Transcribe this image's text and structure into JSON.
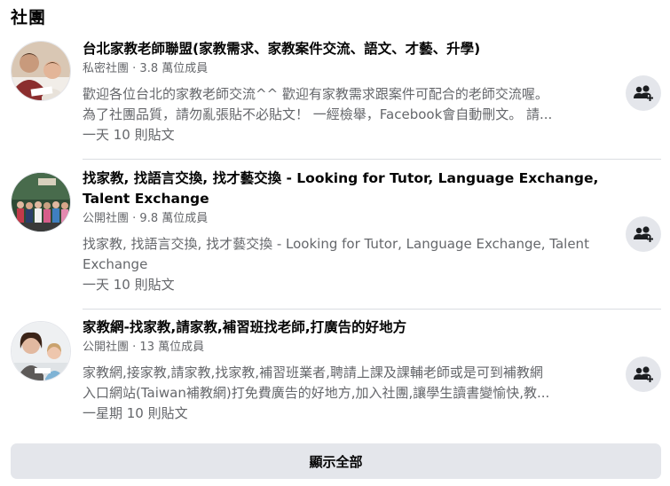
{
  "section": {
    "title": "社團"
  },
  "groups": [
    {
      "name": "台北家教老師聯盟(家教需求、家教案件交流、語文、才藝、升學)",
      "privacy": "私密社團",
      "members": "3.8 萬位成員",
      "description_line1": "歡迎各位台北的家教老師交流^^ 歡迎有家教需求跟案件可配合的老師交流喔。",
      "description_line2": "為了社團品質，請勿亂張貼不必貼文！ 一經檢舉，Facebook會自動刪文。 請...",
      "activity": "一天 10 則貼文",
      "avatar_icon": "tutor-with-child-photo",
      "join_icon": "join-group-icon"
    },
    {
      "name": "找家教, 找語言交換, 找才藝交換 - Looking for Tutor, Language Exchange, Talent Exchange",
      "privacy": "公開社團",
      "members": "9.8 萬位成員",
      "description_line1": "找家教, 找語言交換, 找才藝交換 - Looking for Tutor, Language Exchange, Talent",
      "description_line2": "Exchange",
      "activity": "一天 10 則貼文",
      "avatar_icon": "group-photo",
      "join_icon": "join-group-icon"
    },
    {
      "name": "家教網-找家教,請家教,補習班找老師,打廣告的好地方",
      "privacy": "公開社團",
      "members": "13 萬位成員",
      "description_line1": "家教網,接家教,請家教,找家教,補習班業者,聘請上課及課輔老師或是可到補教網",
      "description_line2": "入口網站(Taiwan補教網)打免費廣告的好地方,加入社團,讓學生讀書變愉快,教...",
      "activity": "一星期 10 則貼文",
      "avatar_icon": "teacher-with-student-photo",
      "join_icon": "join-group-icon"
    }
  ],
  "show_all": {
    "label": "顯示全部"
  },
  "meta_separator": " · ",
  "colors": {
    "secondary_text": "#65676b",
    "button_bg": "#e4e6eb",
    "divider": "#dadde1"
  }
}
